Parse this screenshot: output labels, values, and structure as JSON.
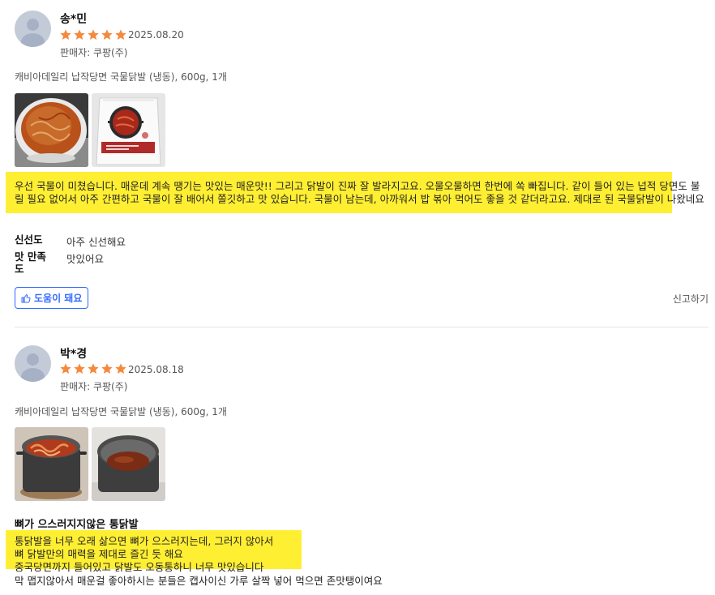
{
  "reviews": [
    {
      "name": "송*민",
      "rating": 5,
      "date": "2025.08.20",
      "seller": "판매자: 쿠팡(주)",
      "product": "캐비아데일리 납작당면 국물닭발 (냉동), 600g, 1개",
      "photos": [
        "spicy-stew-bowl",
        "product-package"
      ],
      "text": "우선 국물이 미쳤습니다. 매운데 계속 땡기는 맛있는 매운맛!! 그리고 닭발이 진짜 잘 발라지고요. 오물오물하면 한번에 쏙 빠집니다. 같이 들어 있는 넙적 당면도 불릴 필요 없어서 아주 간편하고 국물이 잘 배어서 쫄깃하고 맛 있습니다. 국물이 남는데, 아까워서 밥 볶아 먹어도 좋을 것 같더라고요. 제대로 된 국물닭발이 나왔네요",
      "survey": [
        {
          "label": "신선도",
          "value": "아주 신선해요"
        },
        {
          "label": "맛 만족도",
          "value": "맛있어요"
        }
      ],
      "helpful_label": "도움이 돼요",
      "report_label": "신고하기"
    },
    {
      "name": "박*경",
      "rating": 5,
      "date": "2025.08.18",
      "seller": "판매자: 쿠팡(주)",
      "product": "캐비아데일리 납작당면 국물닭발 (냉동), 600g, 1개",
      "photos": [
        "pot-with-stew",
        "pot-with-sauce"
      ],
      "title": "뼈가 으스러지지않은 통닭발",
      "lines": [
        "통닭발을 너무 오래 삶으면 뼈가 으스러지는데, 그러지 않아서",
        "뼈 닭발만의 매력을 제대로 즐긴 듯 해요",
        "중국당면까지 들어있고 닭발도 오동통하니 너무 맛있습니다",
        "막 맵지않아서 매운걸 좋아하시는 분들은 캡사이신 가루 살짝 넣어 먹으면 존맛탱이여요"
      ]
    }
  ],
  "colors": {
    "star": "#f5893d",
    "highlight": "#ffef33",
    "accent": "#346aff"
  }
}
